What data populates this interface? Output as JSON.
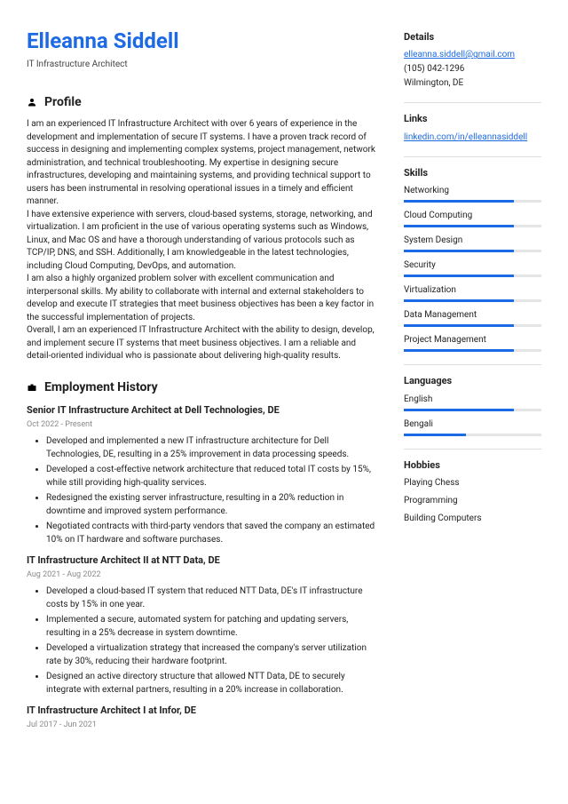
{
  "name": "Elleanna Siddell",
  "title": "IT Infrastructure Architect",
  "sections": {
    "profile": "Profile",
    "employment": "Employment History"
  },
  "profile": [
    "I am an experienced IT Infrastructure Architect with over 6 years of experience in the development and implementation of secure IT systems. I have a proven track record of success in designing and implementing complex systems, project management, network administration, and technical troubleshooting. My expertise in designing secure infrastructures, developing and maintaining systems, and providing technical support to users has been instrumental in resolving operational issues in a timely and efficient manner.",
    "I have extensive experience with servers, cloud-based systems, storage, networking, and virtualization. I am proficient in the use of various operating systems such as Windows, Linux, and Mac OS and have a thorough understanding of various protocols such as TCP/IP, DNS, and SSH. Additionally, I am knowledgeable in the latest technologies, including Cloud Computing, DevOps, and automation.",
    "I am also a highly organized problem solver with excellent communication and interpersonal skills. My ability to collaborate with internal and external stakeholders to develop and execute IT strategies that meet business objectives has been a key factor in the successful implementation of projects.",
    "Overall, I am an experienced IT Infrastructure Architect with the ability to design, develop, and implement secure IT systems that meet business objectives. I am a reliable and detail-oriented individual who is passionate about delivering high-quality results."
  ],
  "jobs": [
    {
      "title": "Senior IT Infrastructure Architect at Dell Technologies, DE",
      "dates": "Oct 2022 - Present",
      "bullets": [
        "Developed and implemented a new IT infrastructure architecture for Dell Technologies, DE, resulting in a 25% improvement in data processing speeds.",
        "Developed a cost-effective network architecture that reduced total IT costs by 15%, while still providing high-quality services.",
        "Redesigned the existing server infrastructure, resulting in a 20% reduction in downtime and improved system performance.",
        "Negotiated contracts with third-party vendors that saved the company an estimated 10% on IT hardware and software purchases."
      ]
    },
    {
      "title": "IT Infrastructure Architect II at NTT Data, DE",
      "dates": "Aug 2021 - Aug 2022",
      "bullets": [
        "Developed a cloud-based IT system that reduced NTT Data, DE's IT infrastructure costs by 15% in one year.",
        "Implemented a secure, automated system for patching and updating servers, resulting in a 25% decrease in system downtime.",
        "Developed a virtualization strategy that increased the company's server utilization rate by 30%, reducing their hardware footprint.",
        "Designed an active directory structure that allowed NTT Data, DE to securely integrate with external partners, resulting in a 20% increase in collaboration."
      ]
    },
    {
      "title": "IT Infrastructure Architect I at Infor, DE",
      "dates": "Jul 2017 - Jun 2021",
      "bullets": []
    }
  ],
  "side": {
    "details_h": "Details",
    "email": "elleanna.siddell@gmail.com",
    "phone": "(105) 042-1296",
    "location": "Wilmington, DE",
    "links_h": "Links",
    "linkedin": "linkedin.com/in/elleannasiddell",
    "skills_h": "Skills",
    "skills": [
      {
        "name": "Networking",
        "pct": 80
      },
      {
        "name": "Cloud Computing",
        "pct": 80
      },
      {
        "name": "System Design",
        "pct": 80
      },
      {
        "name": "Security",
        "pct": 80
      },
      {
        "name": "Virtualization",
        "pct": 80
      },
      {
        "name": "Data Management",
        "pct": 80
      },
      {
        "name": "Project Management",
        "pct": 80
      }
    ],
    "languages_h": "Languages",
    "languages": [
      {
        "name": "English",
        "pct": 80
      },
      {
        "name": "Bengali",
        "pct": 45
      }
    ],
    "hobbies_h": "Hobbies",
    "hobbies": [
      "Playing Chess",
      "Programming",
      "Building Computers"
    ]
  }
}
